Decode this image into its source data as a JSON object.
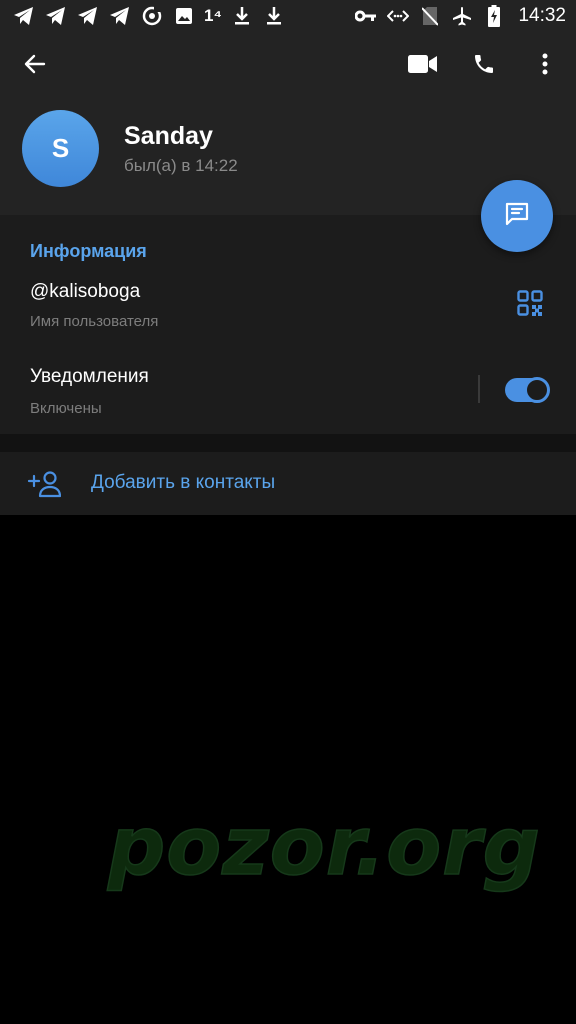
{
  "status_bar": {
    "time": "14:32",
    "left_icons": [
      "telegram-icon",
      "telegram-icon",
      "telegram-icon",
      "telegram-icon",
      "target-icon",
      "image-icon",
      "mobile-data-icon",
      "download-icon",
      "download-icon"
    ],
    "mobile_data_text": "1⁴",
    "right_icons": [
      "key-icon",
      "data-saver-icon",
      "no-sim-icon",
      "airplane-icon",
      "battery-charging-icon"
    ]
  },
  "profile": {
    "avatar_letter": "S",
    "name": "Sanday",
    "last_seen": "был(а) в 14:22"
  },
  "info": {
    "title": "Информация",
    "username": "@kalisoboga",
    "username_label": "Имя пользователя",
    "notifications_label": "Уведомления",
    "notifications_state": "Включены",
    "notifications_on": true
  },
  "actions": {
    "add_contact": "Добавить в контакты"
  },
  "watermark": "pozor.org",
  "colors": {
    "accent": "#4a90e2",
    "header_bg": "#232323",
    "section_bg": "#1c1c1c",
    "page_bg": "#000000"
  }
}
